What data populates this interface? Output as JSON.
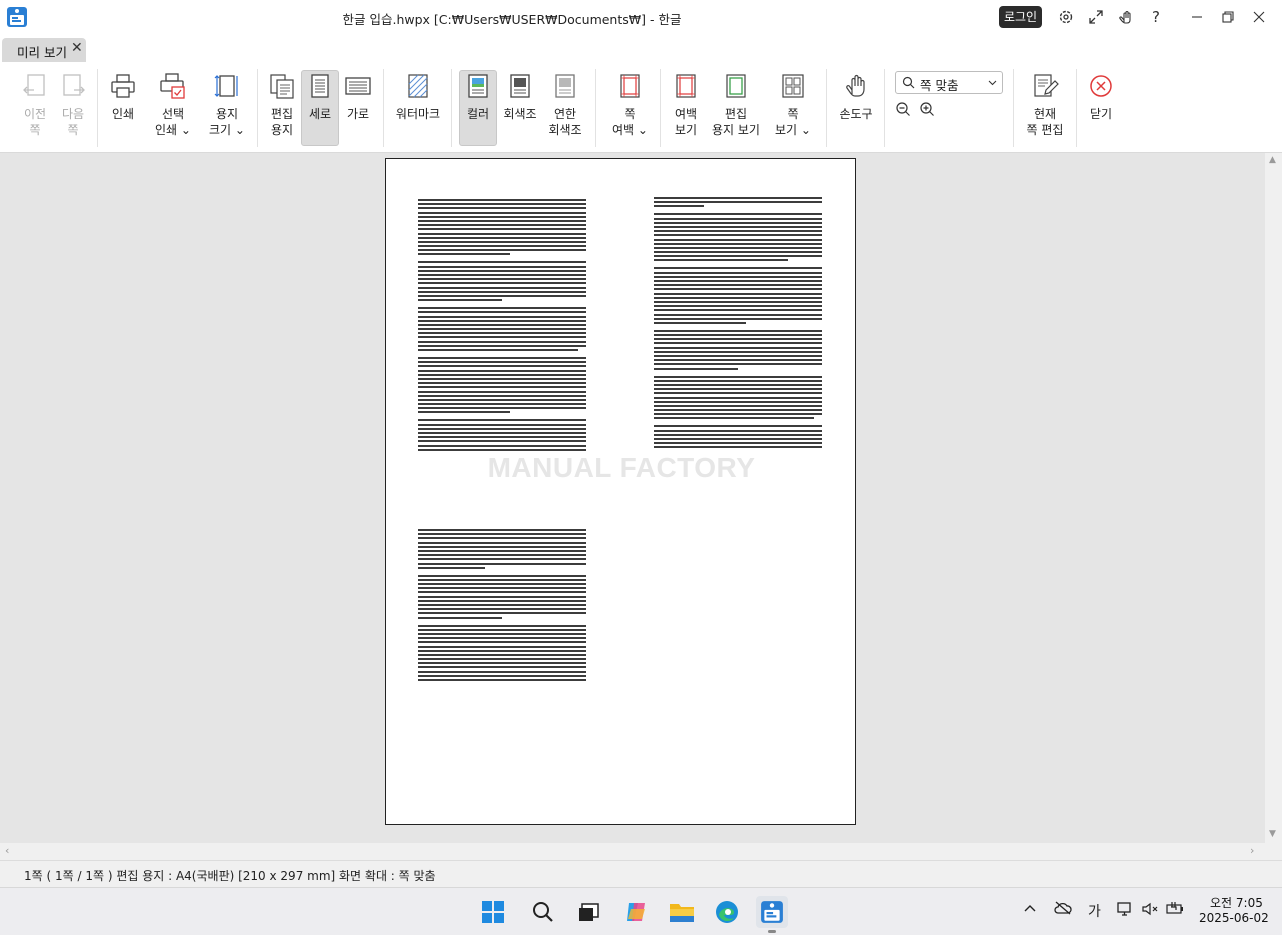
{
  "window": {
    "title": "한글 입습.hwpx [C:₩Users₩USER₩Documents₩] - 한글",
    "login_label": "로그인"
  },
  "tab": {
    "label": "미리 보기",
    "close_glyph": "✕"
  },
  "ribbon": {
    "prev_page": "이전\n쪽",
    "next_page": "다음\n쪽",
    "print": "인쇄",
    "select_print": "선택\n인쇄 ⌄",
    "paper_size": "용지\n크기 ⌄",
    "edit_paper": "편집\n용지",
    "portrait": "세로",
    "landscape": "가로",
    "watermark": "워터마크",
    "color": "컬러",
    "grayscale": "회색조",
    "light_grayscale": "연한\n회색조",
    "page_margin": "쪽\n여백 ⌄",
    "show_margin": "여백\n보기",
    "show_edit_paper": "편집\n용지 보기",
    "page_view": "쪽\n보기 ⌄",
    "hand_tool": "손도구",
    "zoom_value": "쪽 맞춤",
    "edit_current_page": "현재\n쪽 편집",
    "close": "닫기"
  },
  "document": {
    "watermark_text": "MANUAL FACTORY"
  },
  "status": {
    "text": "1쪽 ( 1쪽 / 1쪽 ) 편집 용지 : A4(국배판)  [210 x 297 mm]  화면 확대 : 쪽 맞춤"
  },
  "taskbar": {
    "ime_label": "가",
    "time": "오전 7:05",
    "date": "2025-06-02"
  },
  "colors": {
    "accent_red": "#e03a3a",
    "login_bg": "#2b2b2b",
    "active_button_bg": "#dcdcdc"
  }
}
